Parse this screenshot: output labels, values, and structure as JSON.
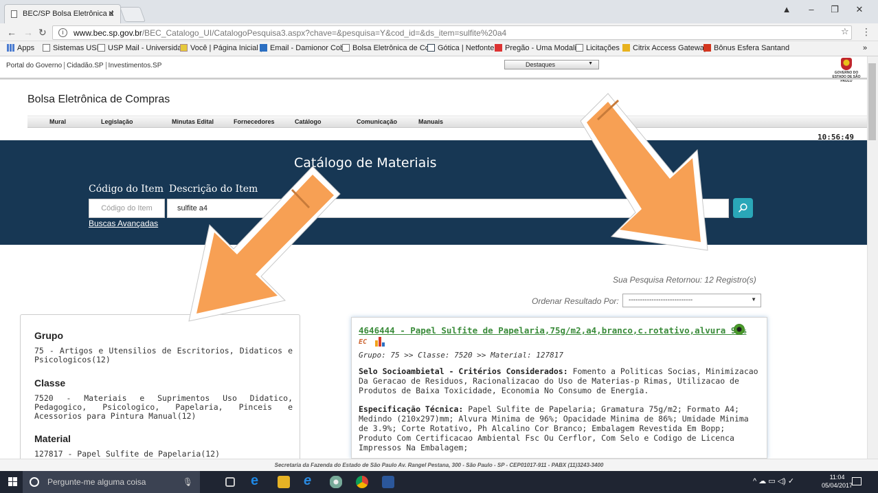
{
  "browser": {
    "tab_title": "BEC/SP Bolsa Eletrônica d",
    "url_host": "www.bec.sp.gov.br",
    "url_path": "/BEC_Catalogo_UI/CatalogoPesquisa3.aspx?chave=&pesquisa=Y&cod_id=&ds_item=sulfite%20a4",
    "bookmarks": [
      "Apps",
      "Sistemas USP",
      "USP Mail - Universida",
      "Você | Página Inicial |",
      "Email - Damionor Cob",
      "Bolsa Eletrônica de Co",
      "Gótica | Netfontes",
      "Pregão - Uma Modali",
      "Licitações",
      "Citrix Access Gateway",
      "Bônus Esfera Santand"
    ],
    "more": "»"
  },
  "gov": {
    "links": [
      "Portal do Governo",
      "Cidadão.SP",
      "Investimentos.SP"
    ],
    "destaques": "Destaques",
    "logo_text": "GOVERNO DO ESTADO DE SÃO PAULO"
  },
  "site": {
    "title": "Bolsa Eletrônica de Compras",
    "nav": [
      "Mural",
      "Legislação",
      "Minutas Edital",
      "Fornecedores",
      "Catálogo",
      "Comunicação",
      "Manuais"
    ],
    "clock": "10:56:49"
  },
  "search": {
    "banner_title": "Catálogo de Materiais",
    "code_label": "Código do Item",
    "desc_label": "Descrição do Item",
    "code_placeholder": "Código do Item",
    "desc_value": "sulfite a4",
    "advanced": "Buscas Avançadas"
  },
  "results": {
    "count_text": "Sua Pesquisa Retornou: 12 Registro(s)",
    "order_label": "Ordenar Resultado Por:",
    "order_value": "----------------------------"
  },
  "filters": {
    "grupo_title": "Grupo",
    "grupo_value": "75 - Artigos e Utensilios de Escritorios, Didaticos e Psicologicos(12)",
    "classe_title": "Classe",
    "classe_value": "7520 - Materiais e Suprimentos Uso Didatico, Pedagogico, Psicologico, Papelaria, Pinceis e Acessorios para Pintura Manual(12)",
    "material_title": "Material",
    "material_value": "127817 - Papel Sulfite de Papelaria(12)"
  },
  "product": {
    "title": "4646444 - Papel Sulfite de Papelaria,75g/m2,a4,branco,c.rotativo,alvura 96%",
    "ec_badge": "EC",
    "hierarchy": "Grupo: 75 >> Classe: 7520 >> Material: 127817",
    "selo_label": "Selo Socioambietal - Critérios Considerados:",
    "selo_text": "Fomento a Politicas Socias, Minimizacao Da Geracao de Residuos, Racionalizacao do Uso de Materias-p Rimas, Utilizacao de Produtos de Baixa Toxicidade, Economia No Consumo de Energia.",
    "spec_label": "Especificação Técnica:",
    "spec_text": "Papel Sulfite de Papelaria; Gramatura 75g/m2; Formato A4; Medindo (210x297)mm; Alvura Minima de 96%; Opacidade Minima de 86%; Umidade Minima de 3.9%; Corte Rotativo, Ph Alcalino Cor Branco; Embalagem Revestida Em Bopp; Produto Com Certificacao Ambiental Fsc Ou Cerflor, Com Selo e Codigo de Licenca Impressos Na Embalagem;"
  },
  "footer": "Secretaria da Fazenda do Estado de São Paulo Av. Rangel Pestana, 300 - São Paulo - SP - CEP01017-911 - PABX (11)3243-3400",
  "taskbar": {
    "search_placeholder": "Pergunte-me alguma coisa",
    "time": "11:04",
    "date": "05/04/2017"
  },
  "colors": {
    "banner": "#173754",
    "accent": "#2aa7b8",
    "arrow": "#f7a054",
    "product_link": "#3a8b3a"
  },
  "icons": [
    "document-icon",
    "close-icon",
    "info-icon",
    "search-icon",
    "star-icon",
    "menu-icon",
    "windows-icon",
    "cortana-icon",
    "mic-icon"
  ]
}
